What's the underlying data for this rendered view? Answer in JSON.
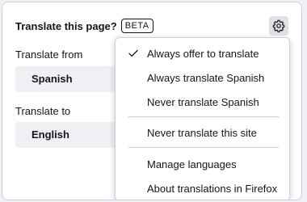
{
  "panel": {
    "title": "Translate this page?",
    "badge": "BETA",
    "from_label": "Translate from",
    "from_value": "Spanish",
    "to_label": "Translate to",
    "to_value": "English"
  },
  "menu": {
    "items": [
      {
        "label": "Always offer to translate",
        "checked": true
      },
      {
        "label": "Always translate Spanish",
        "checked": false
      },
      {
        "label": "Never translate Spanish",
        "checked": false
      },
      {
        "label": "Never translate this site",
        "checked": false
      },
      {
        "label": "Manage languages",
        "checked": false
      },
      {
        "label": "About translations in Firefox",
        "checked": false
      }
    ]
  },
  "icons": {
    "settings": "gear-icon",
    "check": "checkmark-icon"
  },
  "colors": {
    "panel_bg": "#ffffff",
    "field_bg": "#f0f0f4",
    "text": "#15141a",
    "gear_button_bg": "#e0e0e6"
  }
}
